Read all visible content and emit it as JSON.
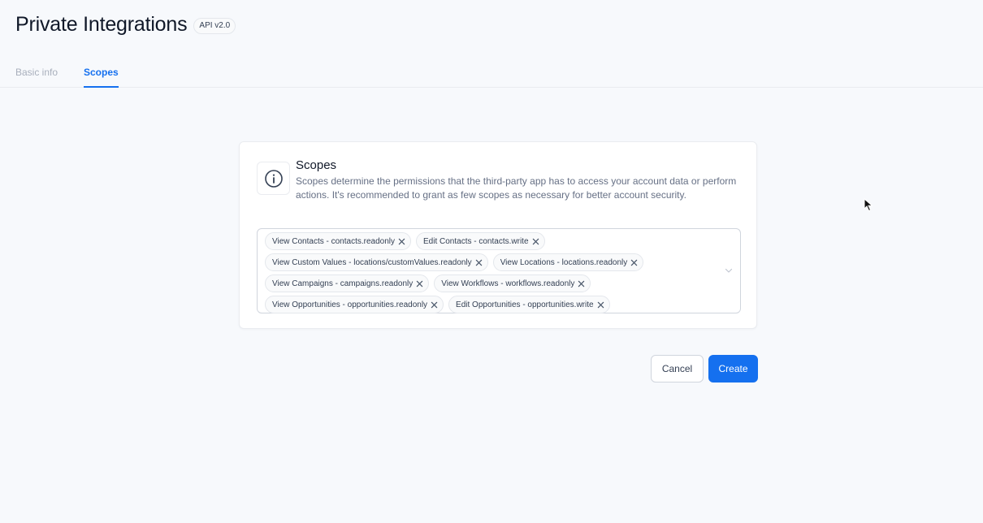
{
  "header": {
    "title": "Private Integrations",
    "version_badge": "API v2.0"
  },
  "tabs": [
    {
      "label": "Basic info",
      "active": false
    },
    {
      "label": "Scopes",
      "active": true
    }
  ],
  "scopes_card": {
    "title": "Scopes",
    "description": "Scopes determine the permissions that the third-party app has to access your account data or perform actions. It's recommended to grant as few scopes as necessary for better account security.",
    "icon": "info-icon",
    "selected_scopes": [
      "View Contacts - contacts.readonly",
      "Edit Contacts - contacts.write",
      "View Custom Values - locations/customValues.readonly",
      "View Locations - locations.readonly",
      "View Campaigns - campaigns.readonly",
      "View Workflows - workflows.readonly",
      "View Opportunities - opportunities.readonly",
      "Edit Opportunities - opportunities.write"
    ]
  },
  "actions": {
    "cancel_label": "Cancel",
    "create_label": "Create"
  },
  "colors": {
    "accent": "#1570ef",
    "background": "#f7f9fc",
    "muted_text": "#667085"
  }
}
